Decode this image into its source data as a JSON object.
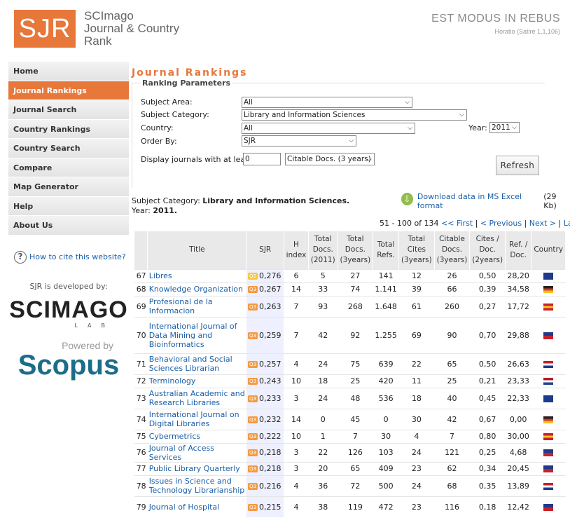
{
  "header": {
    "logo": "SJR",
    "logo_line1": "SCImago",
    "logo_line2": "Journal & Country",
    "logo_line3": "Rank",
    "motto": "EST MODUS IN REBUS",
    "motto_source": "Horatio (Satire 1,1,106)"
  },
  "sidebar": {
    "items": [
      {
        "label": "Home"
      },
      {
        "label": "Journal Rankings"
      },
      {
        "label": "Journal Search"
      },
      {
        "label": "Country Rankings"
      },
      {
        "label": "Country Search"
      },
      {
        "label": "Compare"
      },
      {
        "label": "Map Generator"
      },
      {
        "label": "Help"
      },
      {
        "label": "About Us"
      }
    ],
    "cite_link": "How to cite this website?",
    "developed_by": "SJR is developed by:",
    "scimago_logo": "SCIMAGO",
    "scimago_lab": "LAB",
    "powered_by": "Powered by",
    "scopus_logo": "Scopus"
  },
  "main": {
    "title": "Journal Rankings",
    "params": {
      "legend": "Ranking Parameters",
      "subject_area_label": "Subject Area:",
      "subject_area_value": "All",
      "subject_category_label": "Subject Category:",
      "subject_category_value": "Library and Information Sciences",
      "country_label": "Country:",
      "country_value": "All",
      "year_label": "Year:",
      "year_value": "2011",
      "order_by_label": "Order By:",
      "order_by_value": "SJR",
      "min_label": "Display journals with at least:",
      "min_value": "0",
      "min_type": "Citable Docs. (3 years)",
      "refresh": "Refresh"
    },
    "subject_prefix": "Subject Category: ",
    "subject_value": "Library and Information Sciences.",
    "year_prefix": "Year: ",
    "year_value": "2011.",
    "download_link": "Download data in MS Excel format",
    "download_size": "(29 Kb)",
    "pager": {
      "range": "51 - 100 of 134",
      "first": "<< First",
      "previous": "< Previous",
      "next": "Next >",
      "last": "Last >>"
    },
    "columns": [
      "Title",
      "SJR",
      "H index",
      "Total Docs. (2011)",
      "Total Docs. (3years)",
      "Total Refs.",
      "Total Cites (3years)",
      "Citable Docs. (3years)",
      "Cites / Doc. (2years)",
      "Ref. / Doc.",
      "Country"
    ],
    "quartile_colors": {
      "Q1": "#f5c842",
      "Q2": "#f5c842",
      "Q3": "#f59a42"
    },
    "rows": [
      {
        "rank": "67",
        "title": "Libres",
        "q": "Q2",
        "sjr": "0,276",
        "h": "6",
        "docs": "5",
        "docs3": "27",
        "refs": "141",
        "cites3": "12",
        "citable3": "26",
        "cpd": "0,50",
        "rpd": "28,20",
        "flag": "australia-flag"
      },
      {
        "rank": "68",
        "title": "Knowledge Organization",
        "q": "Q3",
        "sjr": "0,267",
        "h": "14",
        "docs": "33",
        "docs3": "74",
        "refs": "1.141",
        "cites3": "39",
        "citable3": "66",
        "cpd": "0,39",
        "rpd": "34,58",
        "flag": "germany-flag"
      },
      {
        "rank": "69",
        "title": "Profesional de la Informacion",
        "q": "Q3",
        "sjr": "0,263",
        "h": "7",
        "docs": "93",
        "docs3": "268",
        "refs": "1.648",
        "cites3": "61",
        "citable3": "260",
        "cpd": "0,27",
        "rpd": "17,72",
        "flag": "spain-flag"
      },
      {
        "rank": "70",
        "title": "International Journal of Data Mining and Bioinformatics",
        "q": "Q3",
        "sjr": "0,259",
        "h": "7",
        "docs": "42",
        "docs3": "92",
        "refs": "1.255",
        "cites3": "69",
        "citable3": "90",
        "cpd": "0,70",
        "rpd": "29,88",
        "flag": "uk-flag"
      },
      {
        "rank": "71",
        "title": "Behavioral and Social Sciences Librarian",
        "q": "Q3",
        "sjr": "0,257",
        "h": "4",
        "docs": "24",
        "docs3": "75",
        "refs": "639",
        "cites3": "22",
        "citable3": "65",
        "cpd": "0,50",
        "rpd": "26,63",
        "flag": "usa-flag"
      },
      {
        "rank": "72",
        "title": "Terminology",
        "q": "Q3",
        "sjr": "0,243",
        "h": "10",
        "docs": "18",
        "docs3": "25",
        "refs": "420",
        "cites3": "11",
        "citable3": "25",
        "cpd": "0,21",
        "rpd": "23,33",
        "flag": "netherlands-flag"
      },
      {
        "rank": "73",
        "title": "Australian Academic and Research Libraries",
        "q": "Q3",
        "sjr": "0,233",
        "h": "3",
        "docs": "24",
        "docs3": "48",
        "refs": "536",
        "cites3": "18",
        "citable3": "40",
        "cpd": "0,45",
        "rpd": "22,33",
        "flag": "australia-flag"
      },
      {
        "rank": "74",
        "title": "International Journal on Digital Libraries",
        "q": "Q3",
        "sjr": "0,232",
        "h": "14",
        "docs": "0",
        "docs3": "45",
        "refs": "0",
        "cites3": "30",
        "citable3": "42",
        "cpd": "0,67",
        "rpd": "0,00",
        "flag": "germany-flag"
      },
      {
        "rank": "75",
        "title": "Cybermetrics",
        "q": "Q3",
        "sjr": "0,222",
        "h": "10",
        "docs": "1",
        "docs3": "7",
        "refs": "30",
        "cites3": "4",
        "citable3": "7",
        "cpd": "0,80",
        "rpd": "30,00",
        "flag": "spain-flag"
      },
      {
        "rank": "76",
        "title": "Journal of Access Services",
        "q": "Q3",
        "sjr": "0,218",
        "h": "3",
        "docs": "22",
        "docs3": "126",
        "refs": "103",
        "cites3": "24",
        "citable3": "121",
        "cpd": "0,25",
        "rpd": "4,68",
        "flag": "uk-flag"
      },
      {
        "rank": "77",
        "title": "Public Library Quarterly",
        "q": "Q3",
        "sjr": "0,218",
        "h": "3",
        "docs": "20",
        "docs3": "65",
        "refs": "409",
        "cites3": "23",
        "citable3": "62",
        "cpd": "0,34",
        "rpd": "20,45",
        "flag": "uk-flag"
      },
      {
        "rank": "78",
        "title": "Issues in Science and Technology Librarianship",
        "q": "Q3",
        "sjr": "0,216",
        "h": "4",
        "docs": "36",
        "docs3": "72",
        "refs": "500",
        "cites3": "24",
        "citable3": "68",
        "cpd": "0,35",
        "rpd": "13,89",
        "flag": "usa-flag"
      },
      {
        "rank": "79",
        "title": "Journal of Hospital",
        "q": "Q3",
        "sjr": "0,215",
        "h": "4",
        "docs": "38",
        "docs3": "119",
        "refs": "472",
        "cites3": "23",
        "citable3": "116",
        "cpd": "0,18",
        "rpd": "12,42",
        "flag": "uk-flag"
      }
    ]
  }
}
